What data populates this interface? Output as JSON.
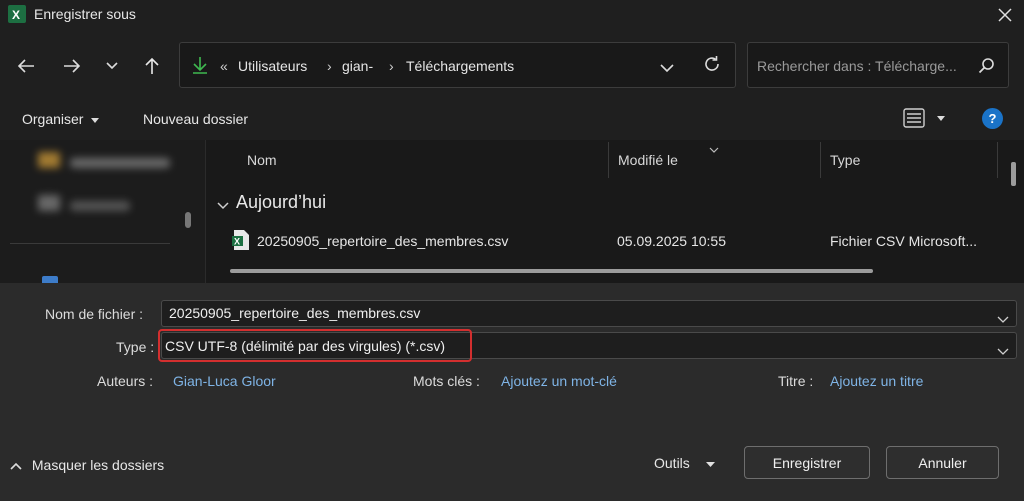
{
  "window": {
    "title": "Enregistrer sous",
    "app_icon": "excel-icon",
    "close_icon": "close-icon"
  },
  "navigation": {
    "back_icon": "arrow-left-icon",
    "forward_icon": "arrow-right-icon",
    "recent_icon": "chevron-down-icon",
    "up_icon": "arrow-up-icon",
    "address": {
      "location_icon": "download-icon",
      "overflow": "«",
      "crumbs": [
        "Utilisateurs",
        "gian-",
        "Téléchargements"
      ],
      "separator": "›",
      "dropdown_icon": "chevron-down-icon",
      "refresh_icon": "refresh-icon"
    },
    "search": {
      "placeholder": "Rechercher dans : Télécharge...",
      "icon": "search-icon"
    }
  },
  "command_bar": {
    "organise_label": "Organiser",
    "new_folder_label": "Nouveau dossier",
    "view_icon": "list-view-icon",
    "help_icon": "help-icon",
    "help_glyph": "?"
  },
  "file_list": {
    "columns": [
      "Nom",
      "Modifié le",
      "Type"
    ],
    "group": "Aujourd’hui",
    "files": [
      {
        "name": "20250905_repertoire_des_membres.csv",
        "modified": "05.09.2025 10:55",
        "type": "Fichier CSV Microsoft...",
        "icon": "csv-file-icon"
      }
    ]
  },
  "form": {
    "filename_label": "Nom de fichier :",
    "filename_value": "20250905_repertoire_des_membres.csv",
    "type_label": "Type :",
    "type_value": "CSV UTF-8 (délimité par des virgules) (*.csv)",
    "authors_label": "Auteurs :",
    "authors_value": "Gian-Luca Gloor",
    "keywords_label": "Mots clés :",
    "keywords_value": "Ajoutez un mot-clé",
    "title_label": "Titre :",
    "title_value": "Ajoutez un titre"
  },
  "footer": {
    "hide_folders_label": "Masquer les dossiers",
    "tools_label": "Outils",
    "save_label": "Enregistrer",
    "cancel_label": "Annuler"
  },
  "colors": {
    "background": "#202020",
    "bottom_pane": "#2b2b2b",
    "link": "#7fb4e6",
    "highlight_box": "#d32f2f",
    "help_blue": "#1a73c8",
    "excel_green": "#1d6f42"
  }
}
